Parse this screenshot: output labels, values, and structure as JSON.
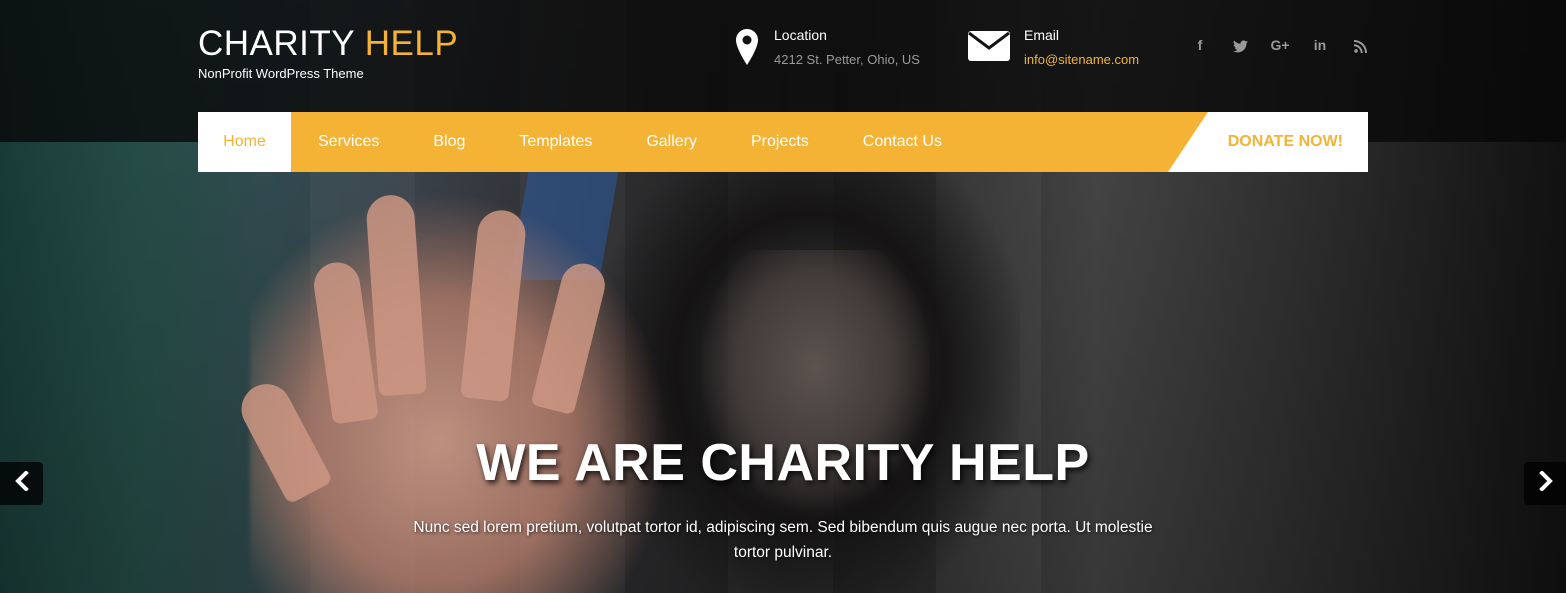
{
  "brand": {
    "title_main": "CHARITY",
    "title_accent": "HELP",
    "tagline": "NonProfit WordPress Theme",
    "accent_color": "#f5b335"
  },
  "contact": {
    "location": {
      "label": "Location",
      "value": "4212 St. Petter, Ohio, US",
      "icon": "map-pin-icon"
    },
    "email": {
      "label": "Email",
      "value": "info@sitename.com",
      "icon": "envelope-icon"
    }
  },
  "social": [
    {
      "name": "facebook",
      "glyph": "f"
    },
    {
      "name": "twitter",
      "glyph": "t"
    },
    {
      "name": "google-plus",
      "glyph": "G+"
    },
    {
      "name": "linkedin",
      "glyph": "in"
    },
    {
      "name": "rss",
      "glyph": "rss"
    }
  ],
  "nav": {
    "items": [
      {
        "label": "Home",
        "active": true
      },
      {
        "label": "Services"
      },
      {
        "label": "Blog"
      },
      {
        "label": "Templates"
      },
      {
        "label": "Gallery"
      },
      {
        "label": "Projects"
      },
      {
        "label": "Contact Us"
      }
    ],
    "donate_label": "DONATE NOW!"
  },
  "hero": {
    "title": "WE ARE CHARITY HELP",
    "subtitle": "Nunc sed lorem pretium, volutpat tortor id, adipiscing sem. Sed bibendum quis augue nec porta. Ut molestie tortor pulvinar."
  },
  "slider": {
    "prev_icon": "chevron-left-icon",
    "next_icon": "chevron-right-icon"
  }
}
